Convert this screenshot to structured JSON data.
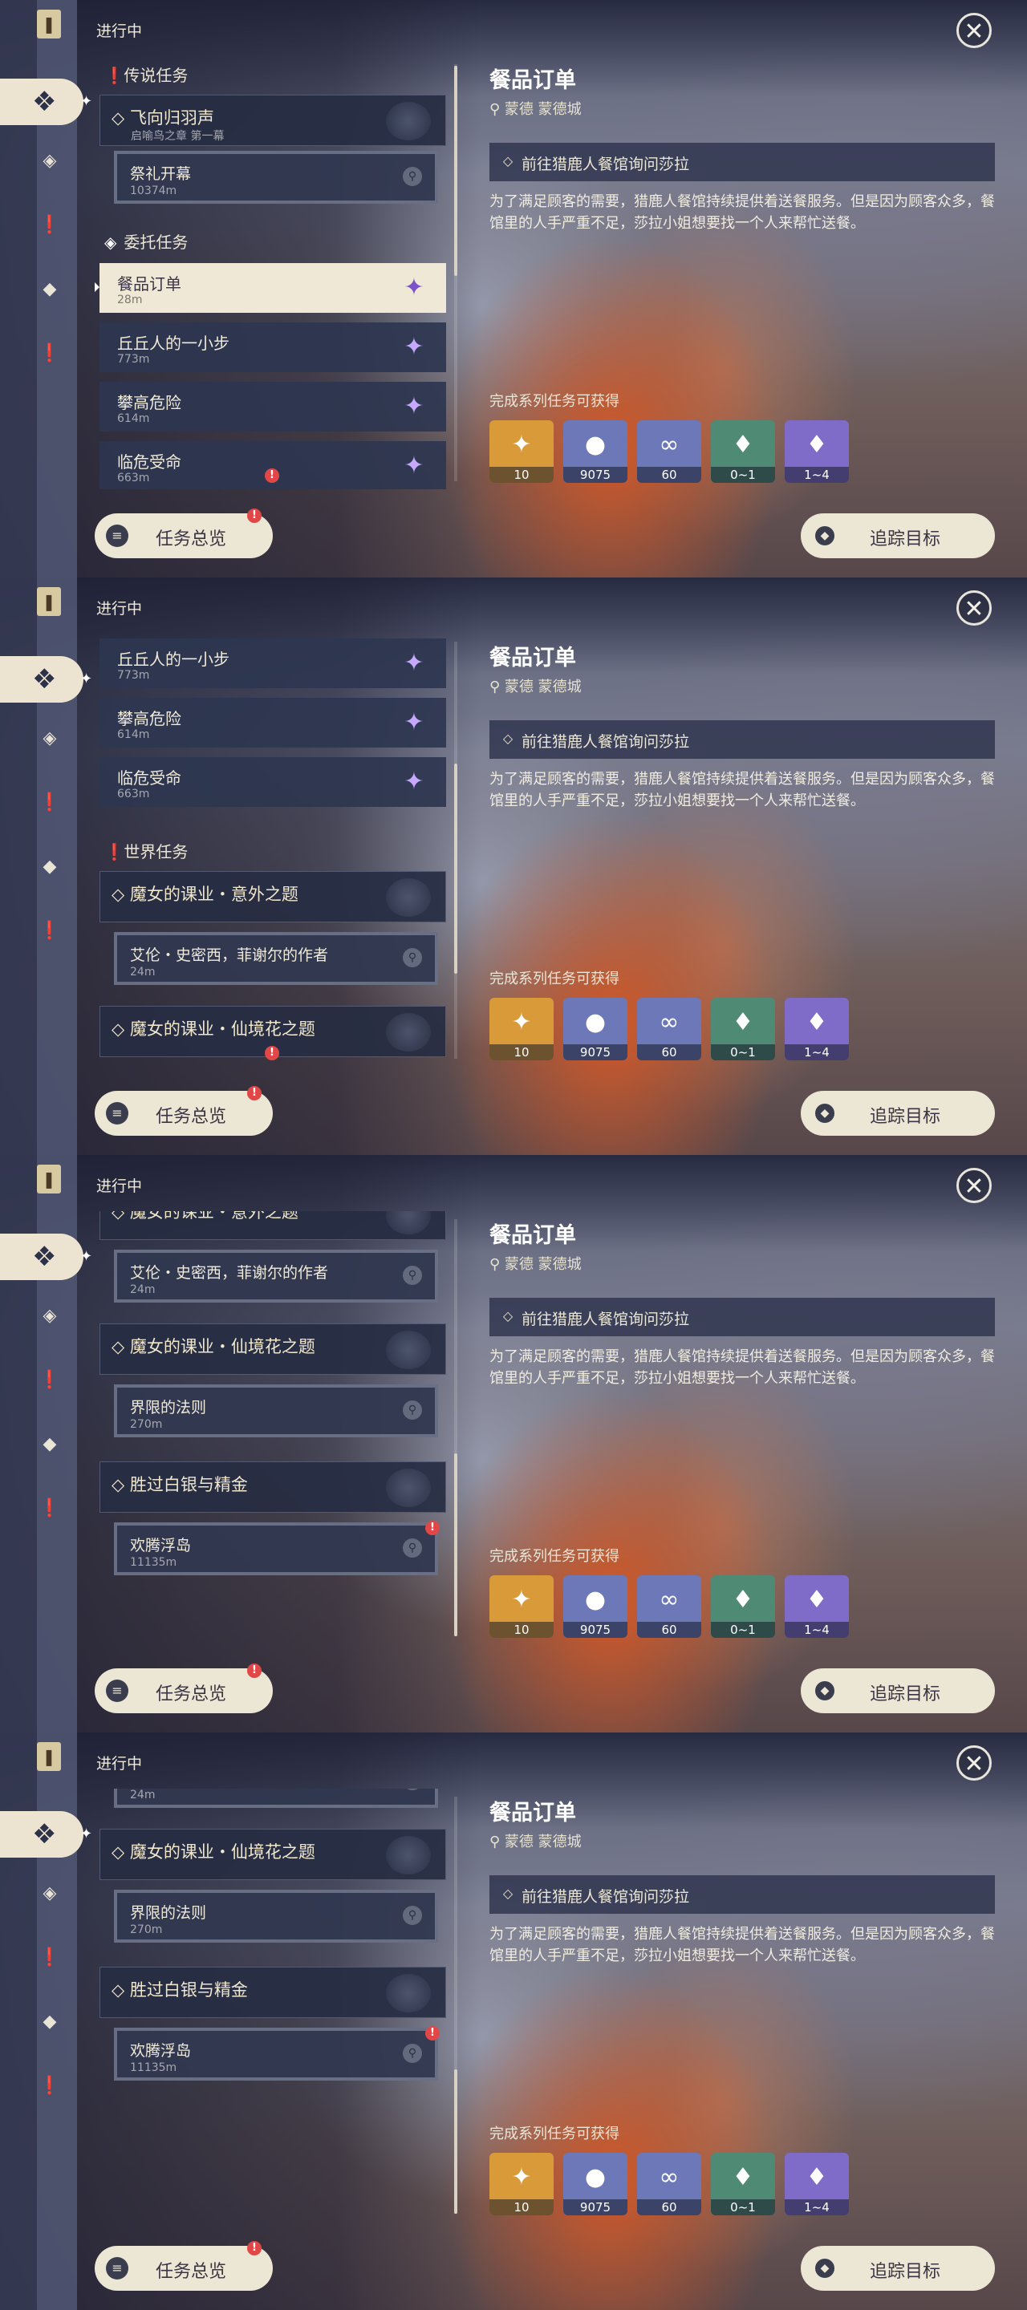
{
  "header": {
    "in_progress": "进行中",
    "close_label": "✕"
  },
  "sidebar": {
    "bookmark": "❚",
    "active_glyph": "❖",
    "items": [
      "◈",
      "❗",
      "◆",
      "❗"
    ]
  },
  "categories": {
    "legend": "传说任务",
    "commission": "委托任务",
    "world": "世界任务"
  },
  "quests": {
    "flying_home": {
      "title": "飞向归羽声",
      "subtitle": "启喻鸟之章 第一幕"
    },
    "rite": {
      "title": "祭礼开幕",
      "dist": "10374m"
    },
    "food_order": {
      "title": "餐品订单",
      "dist": "28m"
    },
    "hilichurl": {
      "title": "丘丘人的一小步",
      "dist": "773m"
    },
    "climb": {
      "title": "攀高危险",
      "dist": "614m"
    },
    "mission": {
      "title": "临危受命",
      "dist": "663m"
    },
    "witch_accident": {
      "title": "魔女的课业・意外之题"
    },
    "allen": {
      "title": "艾伦・史密西，菲谢尔的作者",
      "dist": "24m"
    },
    "witch_flower": {
      "title": "魔女的课业・仙境花之题"
    },
    "boundary": {
      "title": "界限的法则",
      "dist": "270m"
    },
    "silver": {
      "title": "胜过白银与精金"
    },
    "floating": {
      "title": "欢腾浮岛",
      "dist": "11135m"
    }
  },
  "detail": {
    "title": "餐品订单",
    "location": "蒙德 蒙德城",
    "objective": "前往猎鹿人餐馆询问莎拉",
    "description": "为了满足顾客的需要，猎鹿人餐馆持续提供着送餐服务。但是因为顾客众多，餐馆里的人手严重不足，莎拉小姐想要找一个人来帮忙送餐。",
    "rewards_label": "完成系列任务可获得",
    "rewards": [
      {
        "icon": "primogem-icon",
        "glyph": "✦",
        "count": "10",
        "color": "#d99a3a"
      },
      {
        "icon": "mora-icon",
        "glyph": "●",
        "count": "9075",
        "color": "#6d78b8"
      },
      {
        "icon": "adventure-exp-icon",
        "glyph": "∞",
        "count": "60",
        "color": "#6d78b8"
      },
      {
        "icon": "crystal-icon",
        "glyph": "♦",
        "count": "0~1",
        "color": "#4f8a74"
      },
      {
        "icon": "crystal-chunk-icon",
        "glyph": "♦",
        "count": "1~4",
        "color": "#7e6cc8"
      }
    ]
  },
  "buttons": {
    "overview": "任务总览",
    "track": "追踪目标",
    "alert": "!"
  },
  "marks": {
    "diamond": "◇",
    "pin": "⚲",
    "gem": "✦",
    "exclaim": "❗",
    "commission": "◈"
  }
}
